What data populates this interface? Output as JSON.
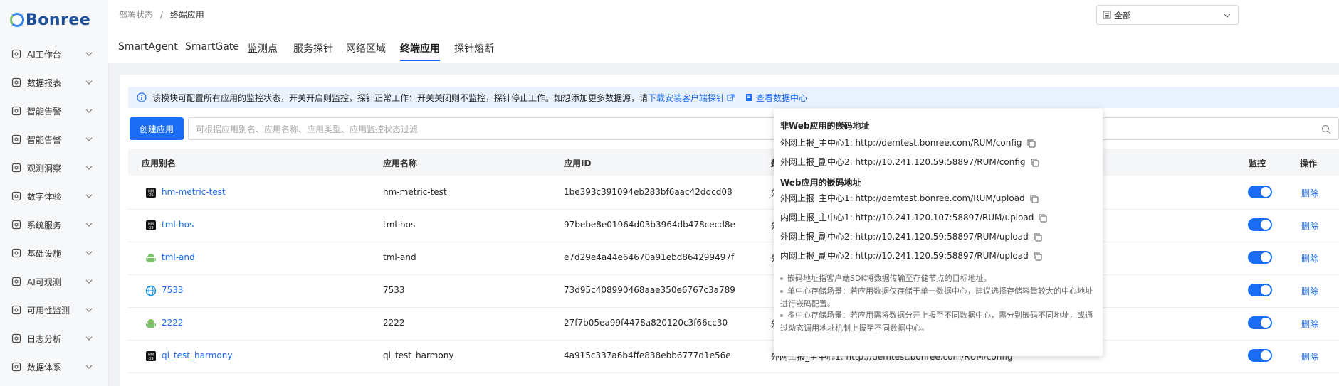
{
  "brand": {
    "logo_text": "Bonree"
  },
  "sidebar": {
    "items": [
      {
        "label": "AI工作台",
        "icon": "robot-icon"
      },
      {
        "label": "数据报表",
        "icon": "chart-icon"
      },
      {
        "label": "智能告警",
        "icon": "alarm-icon"
      },
      {
        "label": "智能告警",
        "icon": "alarm-icon"
      },
      {
        "label": "观测洞察",
        "icon": "insight-icon"
      },
      {
        "label": "数字体验",
        "icon": "user-experience-icon"
      },
      {
        "label": "系统服务",
        "icon": "service-icon"
      },
      {
        "label": "基础设施",
        "icon": "infrastructure-icon"
      },
      {
        "label": "AI可观测",
        "icon": "ai-observe-icon"
      },
      {
        "label": "可用性监测",
        "icon": "availability-icon"
      },
      {
        "label": "日志分析",
        "icon": "log-icon"
      },
      {
        "label": "数据体系",
        "icon": "data-system-icon"
      }
    ]
  },
  "breadcrumb": {
    "parent": "部署状态",
    "separator": "/",
    "current": "终端应用"
  },
  "scope_select": {
    "value": "全部"
  },
  "tabs": [
    "SmartAgent",
    "SmartGate",
    "监测点",
    "服务探针",
    "网络区域",
    "终端应用",
    "探针熔断"
  ],
  "info_bar": {
    "text": "该模块可配置所有应用的监控状态，开关开启则监控，探针正常工作；开关关闭则不监控，探针停止工作。如想添加更多数据源，请",
    "download_link": "下载安装客户端探针",
    "data_center_link": "查看数据中心"
  },
  "toolbar": {
    "create_label": "创建应用",
    "search_placeholder": "可根据应用别名、应用名称、应用类型、应用监控状态过滤"
  },
  "table": {
    "headers": [
      "应用别名",
      "应用名称",
      "应用ID",
      "数",
      "监控",
      "操作"
    ],
    "rows": [
      {
        "alias": "hm-metric-test",
        "name": "hm-metric-test",
        "id": "1be393c391094eb283bf6aac42ddcd08",
        "col4": "外",
        "platform": "harmony-icon"
      },
      {
        "alias": "tml-hos",
        "name": "tml-hos",
        "id": "97bebe8e01964d03b3964db478cecd8e",
        "col4": "外",
        "platform": "harmony-icon"
      },
      {
        "alias": "tml-and",
        "name": "tml-and",
        "id": "e7d29e4a44e64670a91ebd864299497f",
        "col4": "外",
        "platform": "android-icon"
      },
      {
        "alias": "7533",
        "name": "7533",
        "id": "73d95c408990468aae350e6767c3a789",
        "col4": "",
        "platform": "web-icon"
      },
      {
        "alias": "2222",
        "name": "2222",
        "id": "27f7b05ea99f4478a820120c3f66cc30",
        "col4": "外",
        "platform": "android-icon"
      },
      {
        "alias": "ql_test_harmony",
        "name": "ql_test_harmony",
        "id": "4a915c337a6b4ffe838ebb6777d1e56e",
        "col4": "外网上报_主中心1: http://demtest.bonree.com/RUM/config",
        "platform": "harmony-icon"
      }
    ],
    "delete_label": "删除"
  },
  "popover": {
    "non_web_title": "非Web应用的嵌码地址",
    "non_web_lines": [
      "外网上报_主中心1: http://demtest.bonree.com/RUM/config",
      "外网上报_副中心2: http://10.241.120.59:58897/RUM/config"
    ],
    "web_title": "Web应用的嵌码地址",
    "web_lines": [
      "外网上报_主中心1: http://demtest.bonree.com/RUM/upload",
      "内网上报_主中心1: http://10.241.120.107:58897/RUM/upload",
      "外网上报_副中心2: http://10.241.120.59:58897/RUM/upload",
      "内网上报_副中心2: http://10.241.120.59:58897/RUM/upload"
    ],
    "notes": [
      "嵌码地址指客户端SDK将数据传输至存储节点的目标地址。",
      "单中心存储场景：若应用数据仅存储于单一数据中心，建议选择存储容量较大的中心地址进行嵌码配置。",
      "多中心存储场景：若应用需将数据分开上报至不同数据中心，需分别嵌码不同地址，或通过动态调用地址机制上报至不同数据中心。"
    ]
  },
  "colors": {
    "primary": "#1a6cf5",
    "info_bg": "#e9f1fd"
  }
}
